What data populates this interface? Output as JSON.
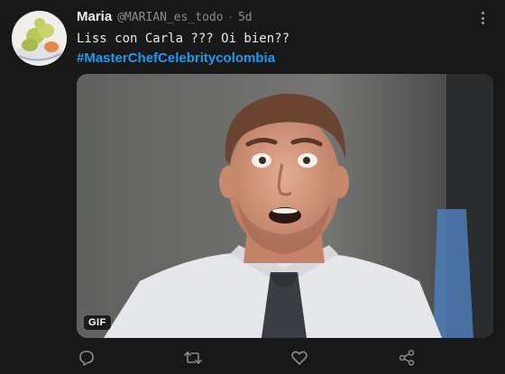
{
  "tweet": {
    "author_name": "Maria",
    "handle": "@MARIAN_es_todo",
    "separator": "·",
    "time": "5d",
    "text": "Liss con Carla ??? Oi bien??",
    "hashtag": "#MasterChefCelebritycolombia",
    "media": {
      "badge": "GIF"
    }
  },
  "actions": {
    "icons": [
      "reply-icon",
      "retweet-icon",
      "like-icon",
      "share-icon"
    ]
  },
  "colors": {
    "background": "#181818",
    "accent": "#1d9bf0",
    "muted": "#8b8b8b"
  }
}
